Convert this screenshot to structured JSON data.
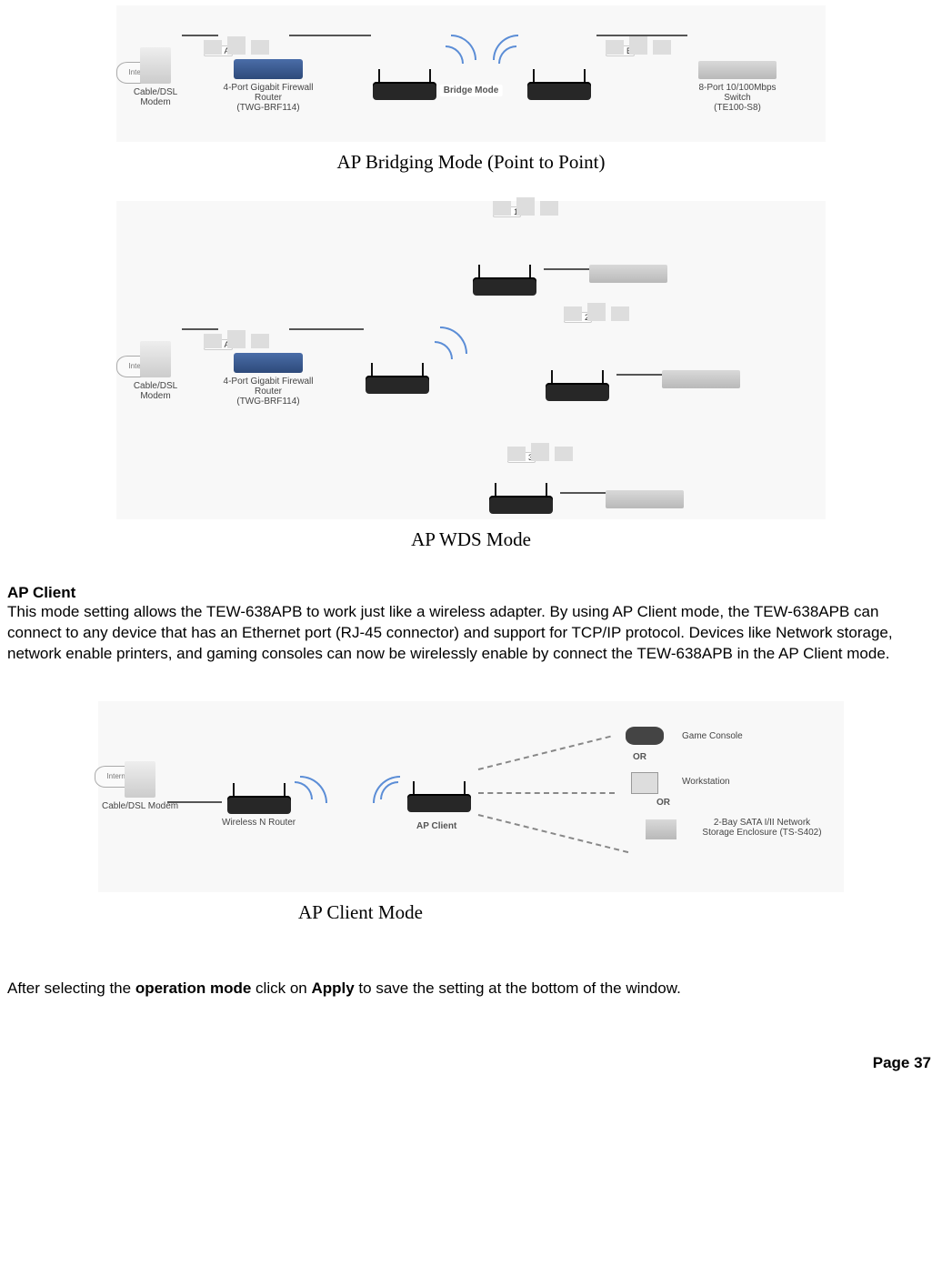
{
  "diagram1": {
    "caption": "AP Bridging Mode (Point to Point)",
    "internet": "Internet",
    "modem": "Cable/DSL\nModem",
    "router": "4-Port Gigabit Firewall Router\n(TWG-BRF114)",
    "lan_a": "LAN A",
    "bridge_mode": "Bridge Mode",
    "lan_b": "LAN B",
    "switch": "8-Port 10/100Mbps Switch\n(TE100-S8)"
  },
  "diagram2": {
    "caption": "AP WDS Mode",
    "internet": "Internet",
    "modem": "Cable/DSL\nModem",
    "router": "4-Port Gigabit Firewall Router\n(TWG-BRF114)",
    "lan_a": "LAN A",
    "lan1": "LAN 1",
    "lan2": "LAN 2",
    "lan3": "LAN 3"
  },
  "section": {
    "title": "AP Client",
    "body": "This mode setting allows the TEW-638APB to work just like a wireless adapter. By using AP Client mode, the TEW-638APB can connect to any device that has an Ethernet port (RJ-45 connector) and support for TCP/IP protocol. Devices like Network storage, network enable printers, and gaming consoles can now be wirelessly enable by connect the TEW-638APB in the AP Client mode."
  },
  "diagram3": {
    "caption": "AP Client Mode",
    "internet": "Internet",
    "modem": "Cable/DSL Modem",
    "wrouter": "Wireless N Router",
    "apclient": "AP Client",
    "game": "Game Console",
    "or": "OR",
    "workstation": "Workstation",
    "nas": "2-Bay SATA I/II Network\nStorage Enclosure\n(TS-S402)"
  },
  "closing": {
    "pre": "After selecting the ",
    "b1": "operation mode",
    "mid": " click on ",
    "b2": "Apply",
    "post": " to save the setting at the bottom of the window."
  },
  "footer": "Page 37"
}
